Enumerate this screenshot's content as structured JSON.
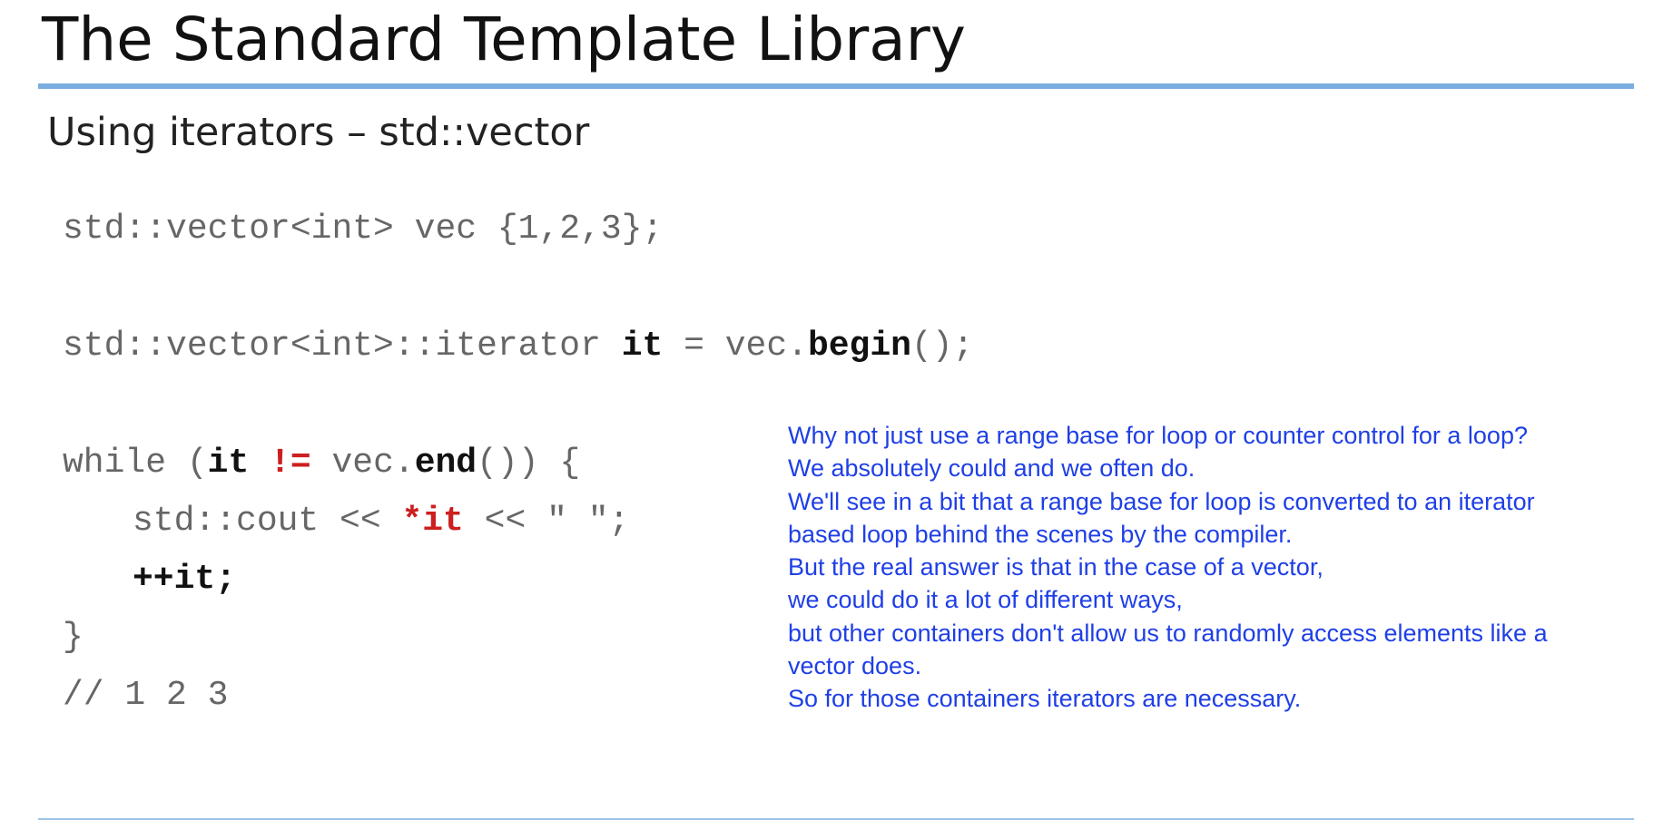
{
  "slide": {
    "title": "The Standard Template Library",
    "subtitle": "Using iterators – std::vector"
  },
  "code": {
    "line1": "std::vector<int> vec {1,2,3};",
    "line2": {
      "a": "std::vector<int>::iterator ",
      "b": "it",
      "c": " = vec.",
      "d": "begin",
      "e": "();"
    },
    "line3": {
      "a": "while (",
      "b": "it",
      "c": " ",
      "d": "!=",
      "e": " vec.",
      "f": "end",
      "g": "()) {"
    },
    "line4": {
      "a": "std::cout << ",
      "b": "*it",
      "c": " << \" \";"
    },
    "line5": "++it;",
    "line6": "}",
    "line7": "// 1 2 3"
  },
  "notes": [
    "Why not just use a range base for loop or counter control for a loop?",
    "We absolutely could and we often do.",
    "We'll see in a bit that a range base for loop is converted to an iterator",
    "based loop behind the scenes by the compiler.",
    "But the real answer is that in the case of a vector,",
    "we could do it a lot of different ways,",
    "but other containers don't allow us to randomly access elements like a",
    "vector does.",
    "So for those containers iterators are necessary."
  ],
  "colors": {
    "accent_rule": "#7aaee0",
    "note_text": "#1f3fe6",
    "code_highlight": "#cc1f1f",
    "code_base": "#666666"
  }
}
